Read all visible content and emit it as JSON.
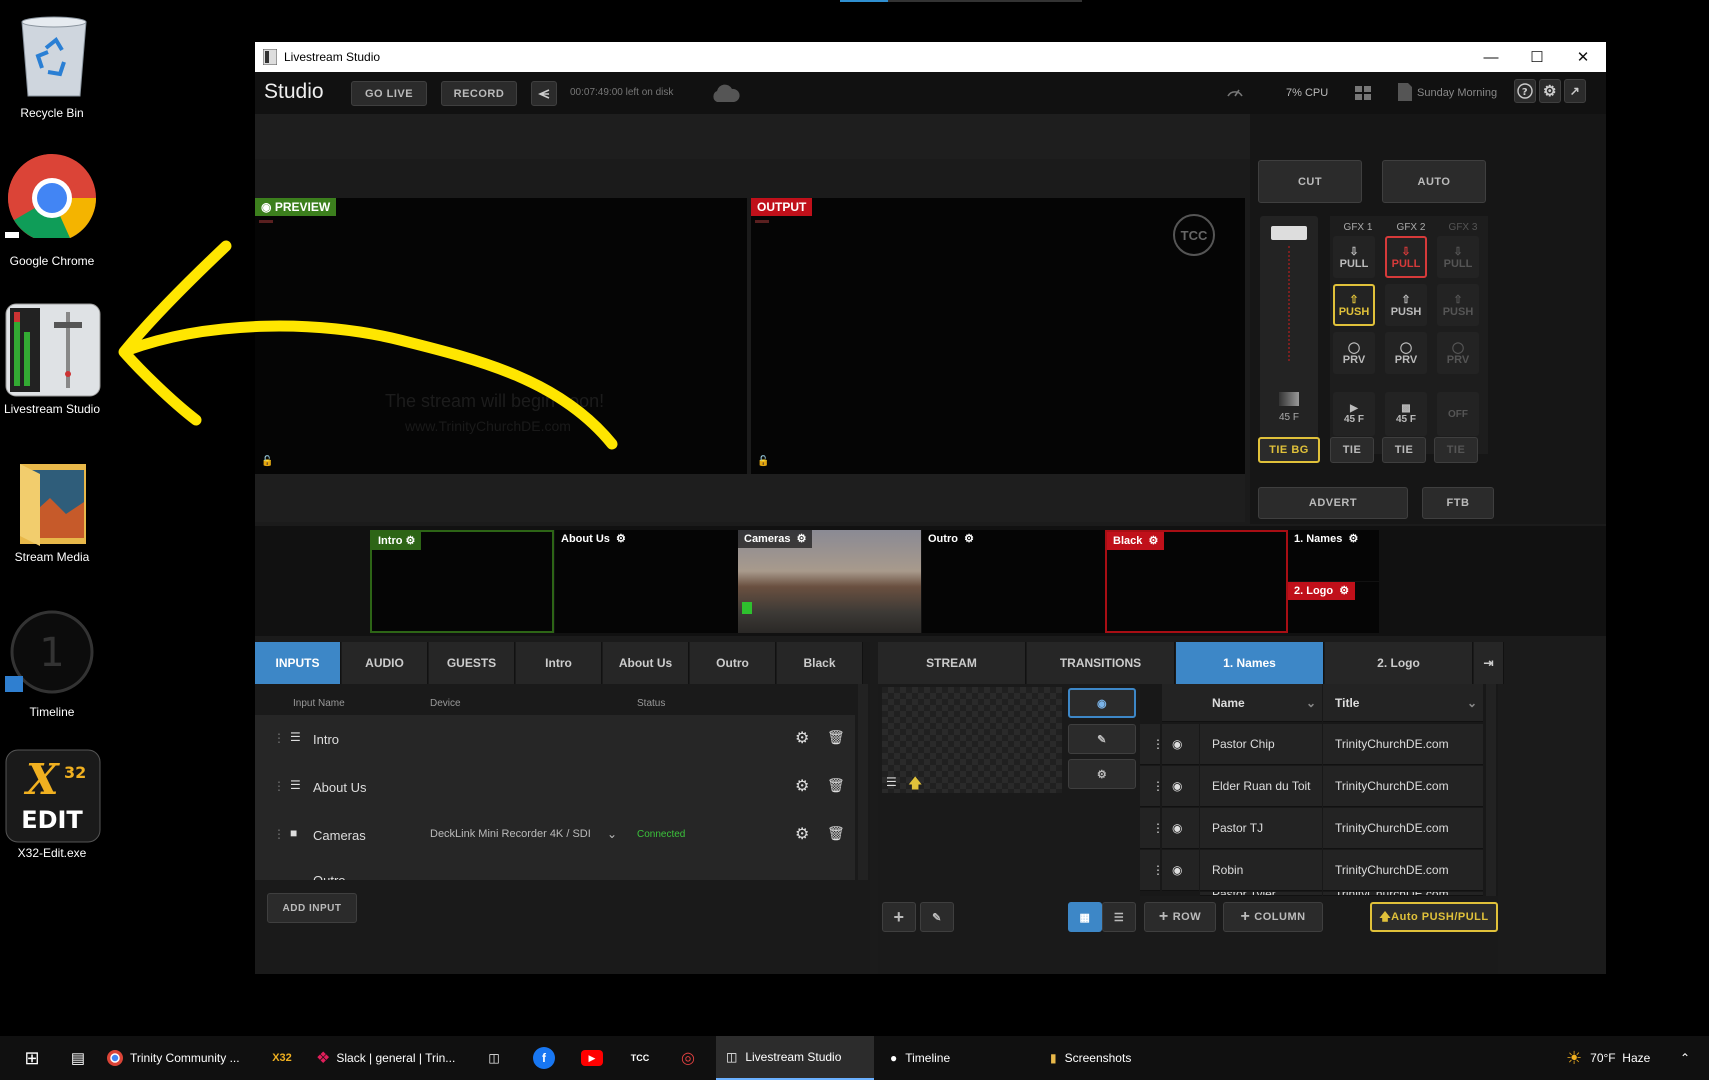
{
  "desktop": {
    "icons": [
      {
        "label": "Recycle Bin",
        "icon": "recycle-bin-icon"
      },
      {
        "label": "Google Chrome",
        "icon": "chrome-icon"
      },
      {
        "label": "Livestream Studio",
        "icon": "livestream-studio-icon"
      },
      {
        "label": "Stream Media",
        "icon": "folder-icon"
      },
      {
        "label": "Timeline",
        "icon": "timeline-icon"
      },
      {
        "label": "X32-Edit.exe",
        "icon": "x32-edit-icon"
      }
    ]
  },
  "window": {
    "title": "Livestream Studio",
    "app_name": "Studio",
    "go_live": "GO LIVE",
    "record": "RECORD",
    "disk_left": "00:07:49:00 left on disk",
    "cpu": "7% CPU",
    "project": "Sunday Morning"
  },
  "monitors": {
    "preview_label": "PREVIEW",
    "output_label": "OUTPUT",
    "output_logo": "TCC",
    "preview_text_line1": "The stream will begin soon!",
    "preview_text_line2": "www.TrinityChurchDE.com"
  },
  "switcher": {
    "cut": "CUT",
    "auto": "AUTO",
    "gfx": [
      {
        "name": "GFX 1",
        "pull": "PULL",
        "push": "PUSH",
        "prv": "PRV",
        "frames": "45 F"
      },
      {
        "name": "GFX 2",
        "pull": "PULL",
        "push": "PUSH",
        "prv": "PRV",
        "frames": "45 F"
      },
      {
        "name": "GFX 3",
        "pull": "PULL",
        "push": "PUSH",
        "prv": "PRV",
        "frames": "OFF"
      }
    ],
    "bg_frames": "45 F",
    "tie_bg": "TIE BG",
    "tie": "TIE",
    "advert": "ADVERT",
    "ftb": "FTB"
  },
  "thumbs": [
    {
      "name": "Intro"
    },
    {
      "name": "About Us"
    },
    {
      "name": "Cameras"
    },
    {
      "name": "Outro"
    },
    {
      "name": "Black"
    },
    {
      "name": "1. Names"
    },
    {
      "name": "2. Logo"
    }
  ],
  "inputs_panel": {
    "tabs": [
      "INPUTS",
      "AUDIO",
      "GUESTS",
      "Intro",
      "About Us",
      "Outro",
      "Black"
    ],
    "col_name": "Input Name",
    "col_device": "Device",
    "col_status": "Status",
    "rows": [
      {
        "name": "Intro",
        "device": "",
        "status": ""
      },
      {
        "name": "About Us",
        "device": "",
        "status": ""
      },
      {
        "name": "Cameras",
        "device": "DeckLink Mini Recorder 4K / SDI",
        "status": "Connected"
      },
      {
        "name": "Outro",
        "device": "",
        "status": ""
      }
    ],
    "add_input": "ADD INPUT"
  },
  "gfx_panel": {
    "tabs": [
      "STREAM",
      "TRANSITIONS",
      "1. Names",
      "2. Logo"
    ],
    "col_name": "Name",
    "col_title": "Title",
    "rows": [
      {
        "name": "Pastor Chip",
        "title": "TrinityChurchDE.com"
      },
      {
        "name": "Elder Ruan du Toit",
        "title": "TrinityChurchDE.com"
      },
      {
        "name": "Pastor TJ",
        "title": "TrinityChurchDE.com"
      },
      {
        "name": "Robin",
        "title": "TrinityChurchDE.com"
      },
      {
        "name": "Pastor Tyler",
        "title": "TrinityChurchDE.com"
      }
    ],
    "add_row": "ROW",
    "add_column": "COLUMN",
    "auto_push_pull": "Auto PUSH/PULL"
  },
  "taskbar": {
    "items": [
      {
        "label": "Trinity Community ...",
        "icon": "chrome-icon"
      },
      {
        "label": "Slack | general | Trin...",
        "icon": "slack-icon"
      },
      {
        "label": "Livestream Studio",
        "icon": "livestream-studio-icon"
      },
      {
        "label": "Timeline",
        "icon": "timeline-icon"
      },
      {
        "label": "Screenshots",
        "icon": "folder-icon"
      }
    ],
    "weather": "70°F  Haze"
  },
  "colors": {
    "accent_blue": "#3d87c7",
    "preview_green": "#3c7f1d",
    "output_red": "#c0101a",
    "annotation_yellow": "#ffe600",
    "gfx_push_yellow": "#e0c13a"
  }
}
